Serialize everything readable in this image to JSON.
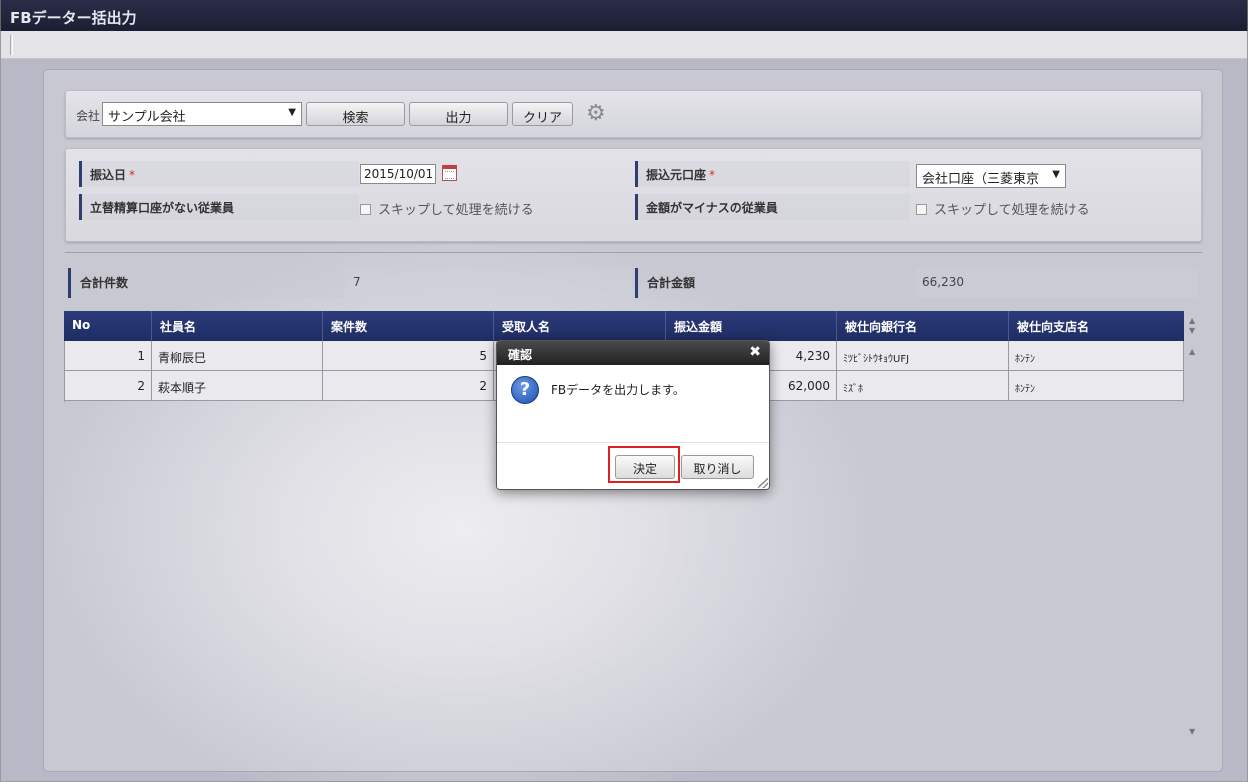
{
  "window": {
    "title": "FBデーター括出力"
  },
  "toolbar": {
    "company_label": "会社",
    "company_value": "サンプル会社",
    "search_label": "検索",
    "output_label": "出力",
    "clear_label": "クリア"
  },
  "form": {
    "transfer_date_label": "振込日",
    "transfer_date_value": "2015/10/01",
    "source_account_label": "振込元口座",
    "source_account_value": "会社口座（三菱東京",
    "required_mark": "*",
    "no_reimb_account_label": "立替精算口座がない従業員",
    "negative_amount_label": "金額がマイナスの従業員",
    "skip_label": "スキップして処理を続ける"
  },
  "summary": {
    "count_label": "合計件数",
    "count_value": "7",
    "amount_label": "合計金額",
    "amount_value": "66,230"
  },
  "grid": {
    "headers": [
      "No",
      "社員名",
      "案件数",
      "受取人名",
      "振込金額",
      "被仕向銀行名",
      "被仕向支店名"
    ],
    "rows": [
      [
        "1",
        "青柳辰巳",
        "5",
        "",
        "4,230",
        "ﾐﾂﾋﾞｼﾄｳｷｮｳUFJ",
        "ﾎﾝﾃﾝ"
      ],
      [
        "2",
        "萩本順子",
        "2",
        "",
        "62,000",
        "ﾐｽﾞﾎ",
        "ﾎﾝﾃﾝ"
      ]
    ]
  },
  "dialog": {
    "title": "確認",
    "message": "FBデータを出力します。",
    "confirm_label": "決定",
    "cancel_label": "取り消し"
  },
  "colors": {
    "header_bg": "#1f2d63",
    "titlebar_bg": "#1c1e33",
    "highlight": "#e02020",
    "required": "#d03030"
  }
}
